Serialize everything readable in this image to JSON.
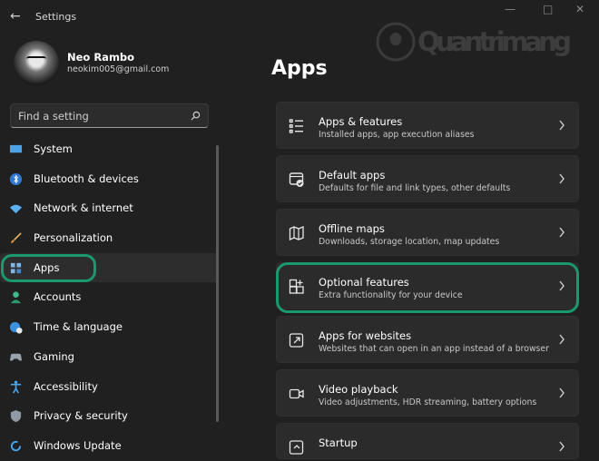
{
  "window": {
    "title": "Settings"
  },
  "user": {
    "name": "Neo Rambo",
    "email": "neokim005@gmail.com"
  },
  "search": {
    "placeholder": "Find a setting"
  },
  "nav": {
    "items": [
      {
        "label": "System",
        "icon": "monitor-icon"
      },
      {
        "label": "Bluetooth & devices",
        "icon": "bluetooth-icon"
      },
      {
        "label": "Network & internet",
        "icon": "wifi-icon"
      },
      {
        "label": "Personalization",
        "icon": "brush-icon"
      },
      {
        "label": "Apps",
        "icon": "apps-icon",
        "selected": true
      },
      {
        "label": "Accounts",
        "icon": "person-icon"
      },
      {
        "label": "Time & language",
        "icon": "globe-clock-icon"
      },
      {
        "label": "Gaming",
        "icon": "gamepad-icon"
      },
      {
        "label": "Accessibility",
        "icon": "accessibility-icon"
      },
      {
        "label": "Privacy & security",
        "icon": "shield-icon"
      },
      {
        "label": "Windows Update",
        "icon": "update-icon"
      }
    ]
  },
  "page": {
    "title": "Apps"
  },
  "watermark": {
    "text": "Quantrimang"
  },
  "cards": [
    {
      "title": "Apps & features",
      "desc": "Installed apps, app execution aliases",
      "icon": "list-icon"
    },
    {
      "title": "Default apps",
      "desc": "Defaults for file and link types, other defaults",
      "icon": "default-apps-icon"
    },
    {
      "title": "Offline maps",
      "desc": "Downloads, storage location, map updates",
      "icon": "map-icon"
    },
    {
      "title": "Optional features",
      "desc": "Extra functionality for your device",
      "icon": "add-grid-icon"
    },
    {
      "title": "Apps for websites",
      "desc": "Websites that can open in an app instead of a browser",
      "icon": "open-link-icon"
    },
    {
      "title": "Video playback",
      "desc": "Video adjustments, HDR streaming, battery options",
      "icon": "video-icon"
    },
    {
      "title": "Startup",
      "desc": "",
      "icon": "startup-icon"
    }
  ],
  "colors": {
    "background": "#202020",
    "card": "#2b2b2b",
    "highlight": "#1a9a6c",
    "accent": "#3b9cff"
  }
}
